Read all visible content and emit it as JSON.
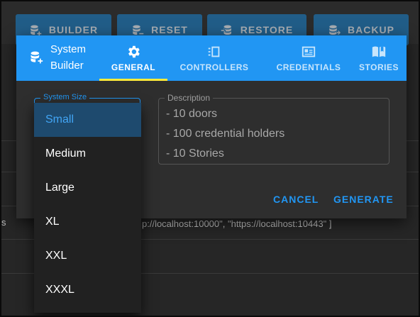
{
  "toolbar": {
    "buttons": [
      {
        "label": "BUILDER",
        "icon": "database-plus-icon"
      },
      {
        "label": "RESET",
        "icon": "database-minus-icon"
      },
      {
        "label": "RESTORE",
        "icon": "database-import-icon"
      },
      {
        "label": "BACKUP",
        "icon": "database-export-icon"
      }
    ]
  },
  "background": {
    "row_text_left": "s",
    "row_text_urls": "p://localhost:10000\", \"https://localhost:10443\" ]"
  },
  "dialog": {
    "title_line1": "System",
    "title_line2": "Builder",
    "tabs": [
      {
        "label": "GENERAL",
        "icon": "gear-icon",
        "active": true
      },
      {
        "label": "CONTROLLERS",
        "icon": "controller-icon",
        "active": false
      },
      {
        "label": "CREDENTIALS",
        "icon": "id-card-icon",
        "active": false
      },
      {
        "label": "STORIES",
        "icon": "book-icon",
        "active": false
      }
    ],
    "size_field": {
      "label": "System Size",
      "value": "Small"
    },
    "description": {
      "label": "Description",
      "lines": [
        "- 10 doors",
        "- 100 credential holders",
        "- 10 Stories"
      ]
    },
    "actions": {
      "cancel": "CANCEL",
      "generate": "GENERATE"
    }
  },
  "size_menu": {
    "options": [
      "Small",
      "Medium",
      "Large",
      "XL",
      "XXL",
      "XXXL"
    ],
    "selected": "Small"
  },
  "colors": {
    "accent": "#2196f3",
    "tab_indicator": "#ffeb3b",
    "selected_bg": "#1e4a6e"
  }
}
